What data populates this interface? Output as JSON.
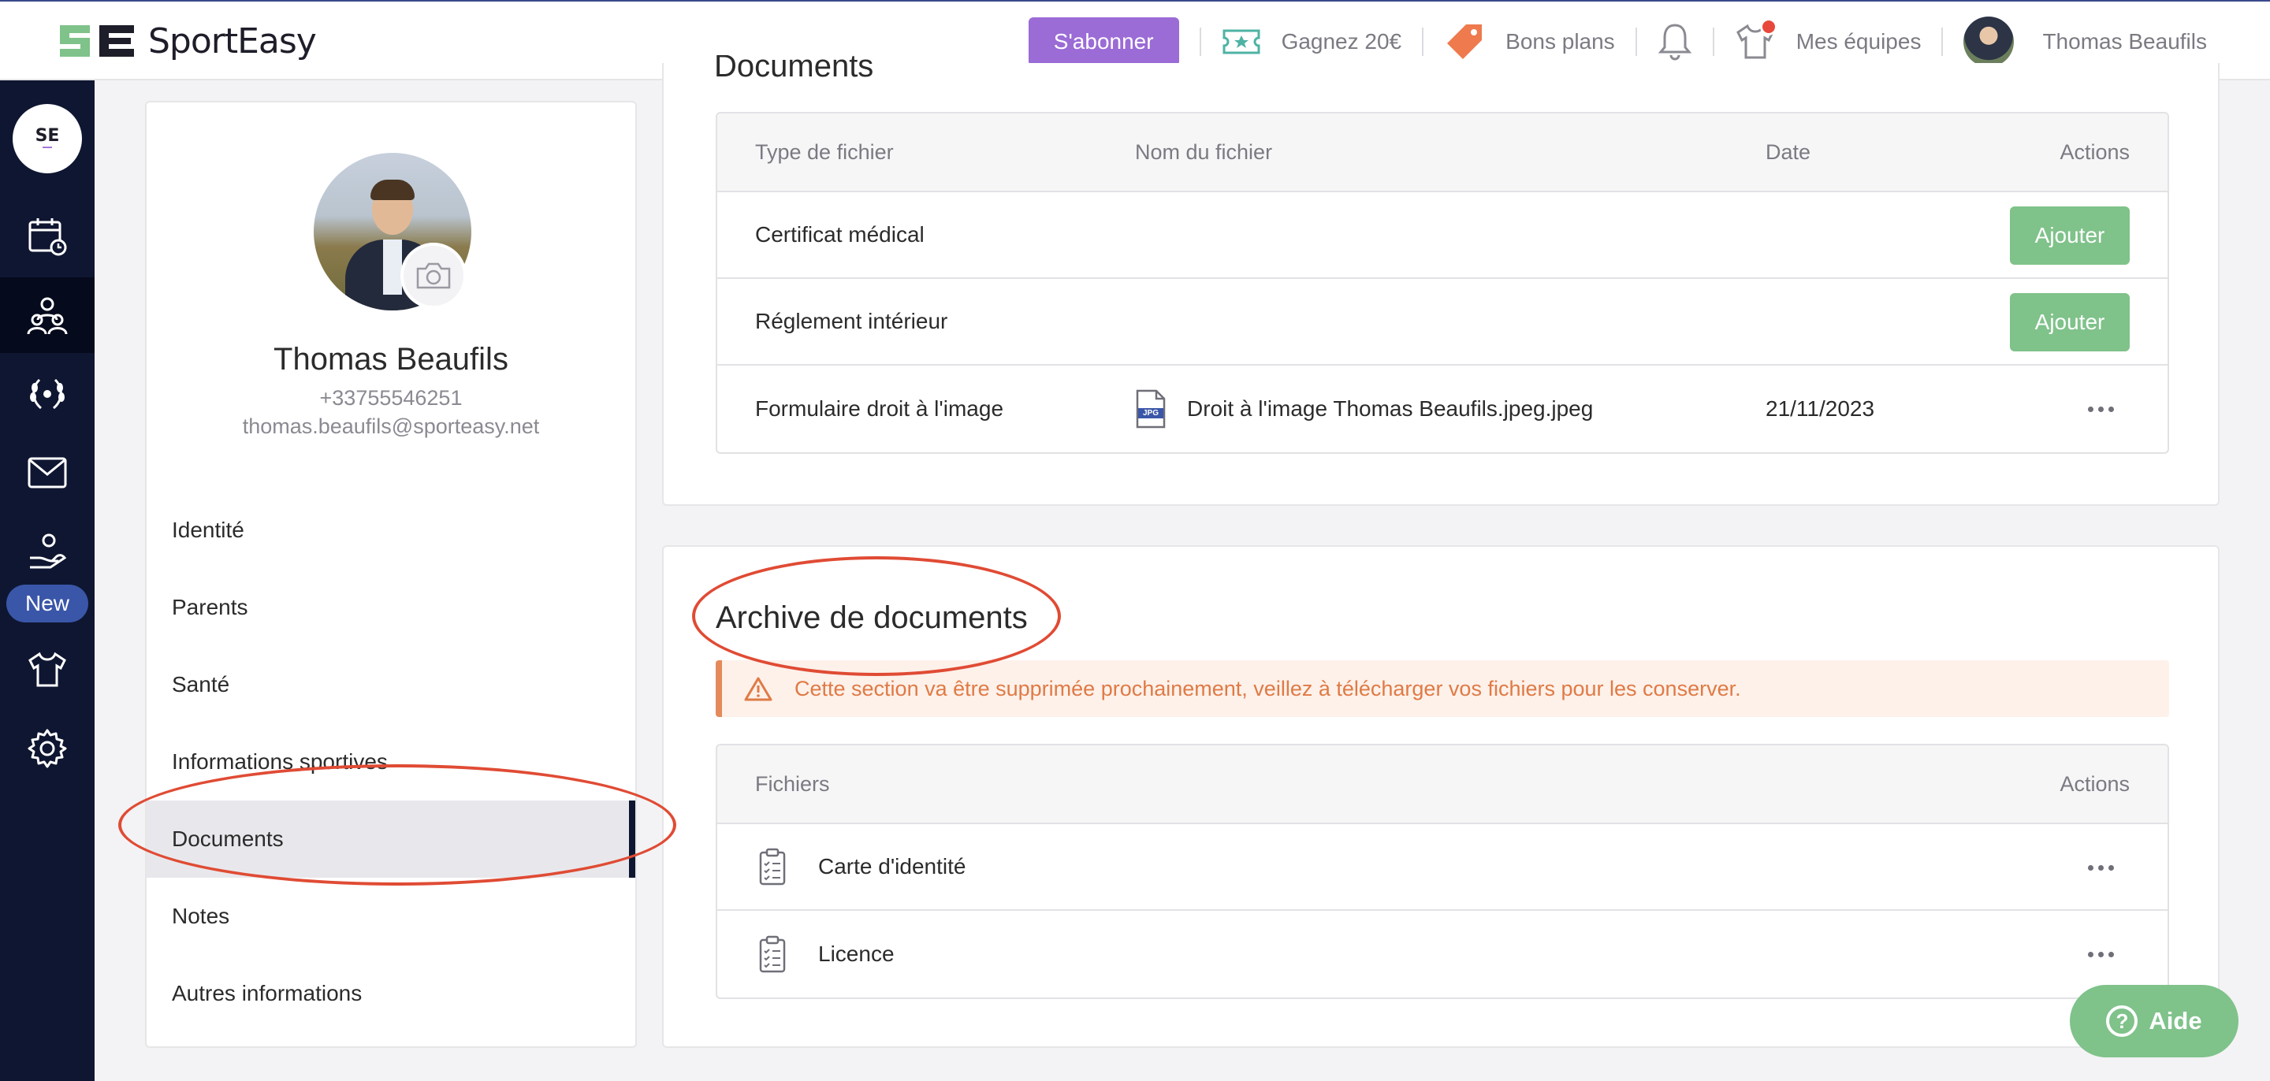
{
  "topbar": {
    "brand": "SportEasy",
    "subscribe_label": "S'abonner",
    "refer_label": "Gagnez 20€",
    "deals_label": "Bons plans",
    "teams_label": "Mes équipes",
    "user_name": "Thomas Beaufils"
  },
  "sidebar": {
    "new_badge": "New"
  },
  "profile": {
    "name": "Thomas Beaufils",
    "phone": "+33755546251",
    "email": "thomas.beaufils@sporteasy.net",
    "menu": [
      {
        "label": "Identité"
      },
      {
        "label": "Parents"
      },
      {
        "label": "Santé"
      },
      {
        "label": "Informations sportives"
      },
      {
        "label": "Documents"
      },
      {
        "label": "Notes"
      },
      {
        "label": "Autres informations"
      }
    ]
  },
  "documents": {
    "title": "Documents",
    "headers": {
      "type": "Type de fichier",
      "name": "Nom du fichier",
      "date": "Date",
      "actions": "Actions"
    },
    "rows": [
      {
        "type": "Certificat médical",
        "action": "Ajouter"
      },
      {
        "type": "Réglement intérieur",
        "action": "Ajouter"
      },
      {
        "type": "Formulaire droit à l'image",
        "file_name": "Droit à l'image Thomas Beaufils.jpeg.jpeg",
        "file_badge": "JPG",
        "date": "21/11/2023"
      }
    ]
  },
  "archive": {
    "title": "Archive de documents",
    "warning": "Cette section va être supprimée prochainement, veillez à télécharger vos fichiers pour les conserver.",
    "headers": {
      "files": "Fichiers",
      "actions": "Actions"
    },
    "rows": [
      {
        "name": "Carte d'identité"
      },
      {
        "name": "Licence"
      }
    ]
  },
  "help": {
    "label": "Aide"
  },
  "colors": {
    "accent_purple": "#9b6bd6",
    "sidebar_navy": "#0f1631",
    "success_green": "#7fc28a",
    "warning_orange": "#e07a45",
    "annotation_red": "#e04b34"
  }
}
